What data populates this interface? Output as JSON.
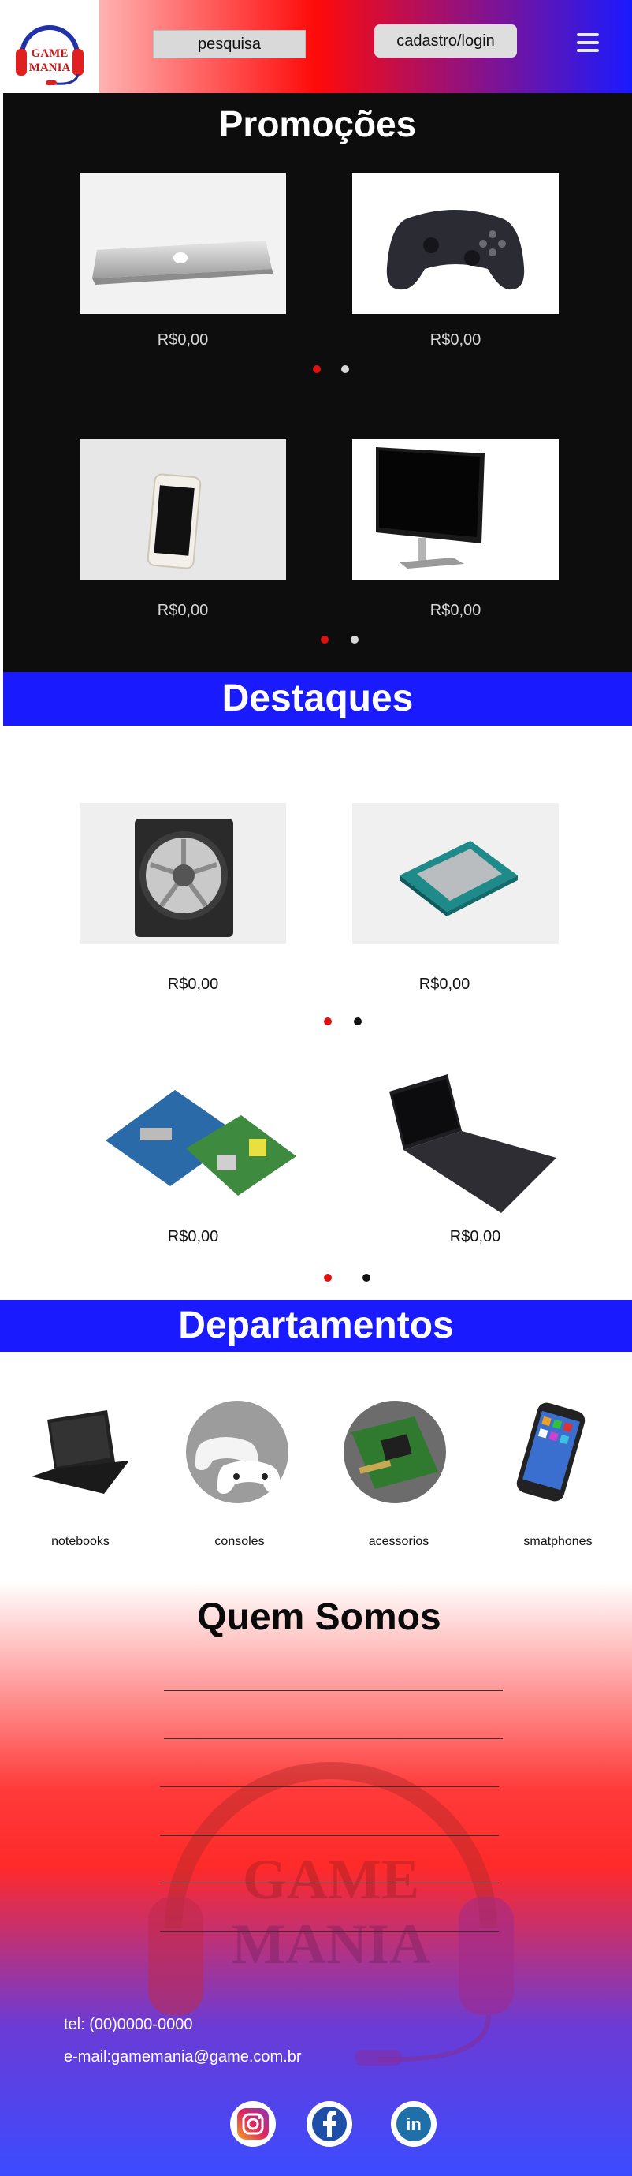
{
  "header": {
    "logo_line1": "GAME",
    "logo_line2": "MANIA",
    "search_label": "pesquisa",
    "login_label": "cadastro/login",
    "menu_icon": "hamburger-menu-icon"
  },
  "promo": {
    "title": "Promoções",
    "rows": [
      [
        {
          "name": "laptop",
          "price": "R$0,00"
        },
        {
          "name": "gamepad",
          "price": "R$0,00"
        }
      ],
      [
        {
          "name": "smartphone",
          "price": "R$0,00"
        },
        {
          "name": "monitor",
          "price": "R$0,00"
        }
      ]
    ]
  },
  "highlights": {
    "title": "Destaques",
    "rows": [
      [
        {
          "name": "cpu-cooler",
          "price": "R$0,00"
        },
        {
          "name": "processor",
          "price": "R$0,00"
        }
      ],
      [
        {
          "name": "arduino-boards",
          "price": "R$0,00"
        },
        {
          "name": "notebook",
          "price": "R$0,00"
        }
      ]
    ]
  },
  "departments": {
    "title": "Departamentos",
    "items": [
      {
        "label": "notebooks"
      },
      {
        "label": "consoles"
      },
      {
        "label": "acessorios"
      },
      {
        "label": "smatphones"
      }
    ]
  },
  "about": {
    "title": "Quem Somos",
    "watermark_line1": "GAME",
    "watermark_line2": "MANIA",
    "tel": "tel: (00)0000-0000",
    "email_label": "e-mail:",
    "email": "gamemania@game.com.br"
  },
  "social": [
    "instagram-icon",
    "facebook-icon",
    "linkedin-icon"
  ],
  "colors": {
    "red": "#ff0a0a",
    "blue": "#1a1aff",
    "dark": "#0d0d0d",
    "dot_red": "#e01010"
  }
}
